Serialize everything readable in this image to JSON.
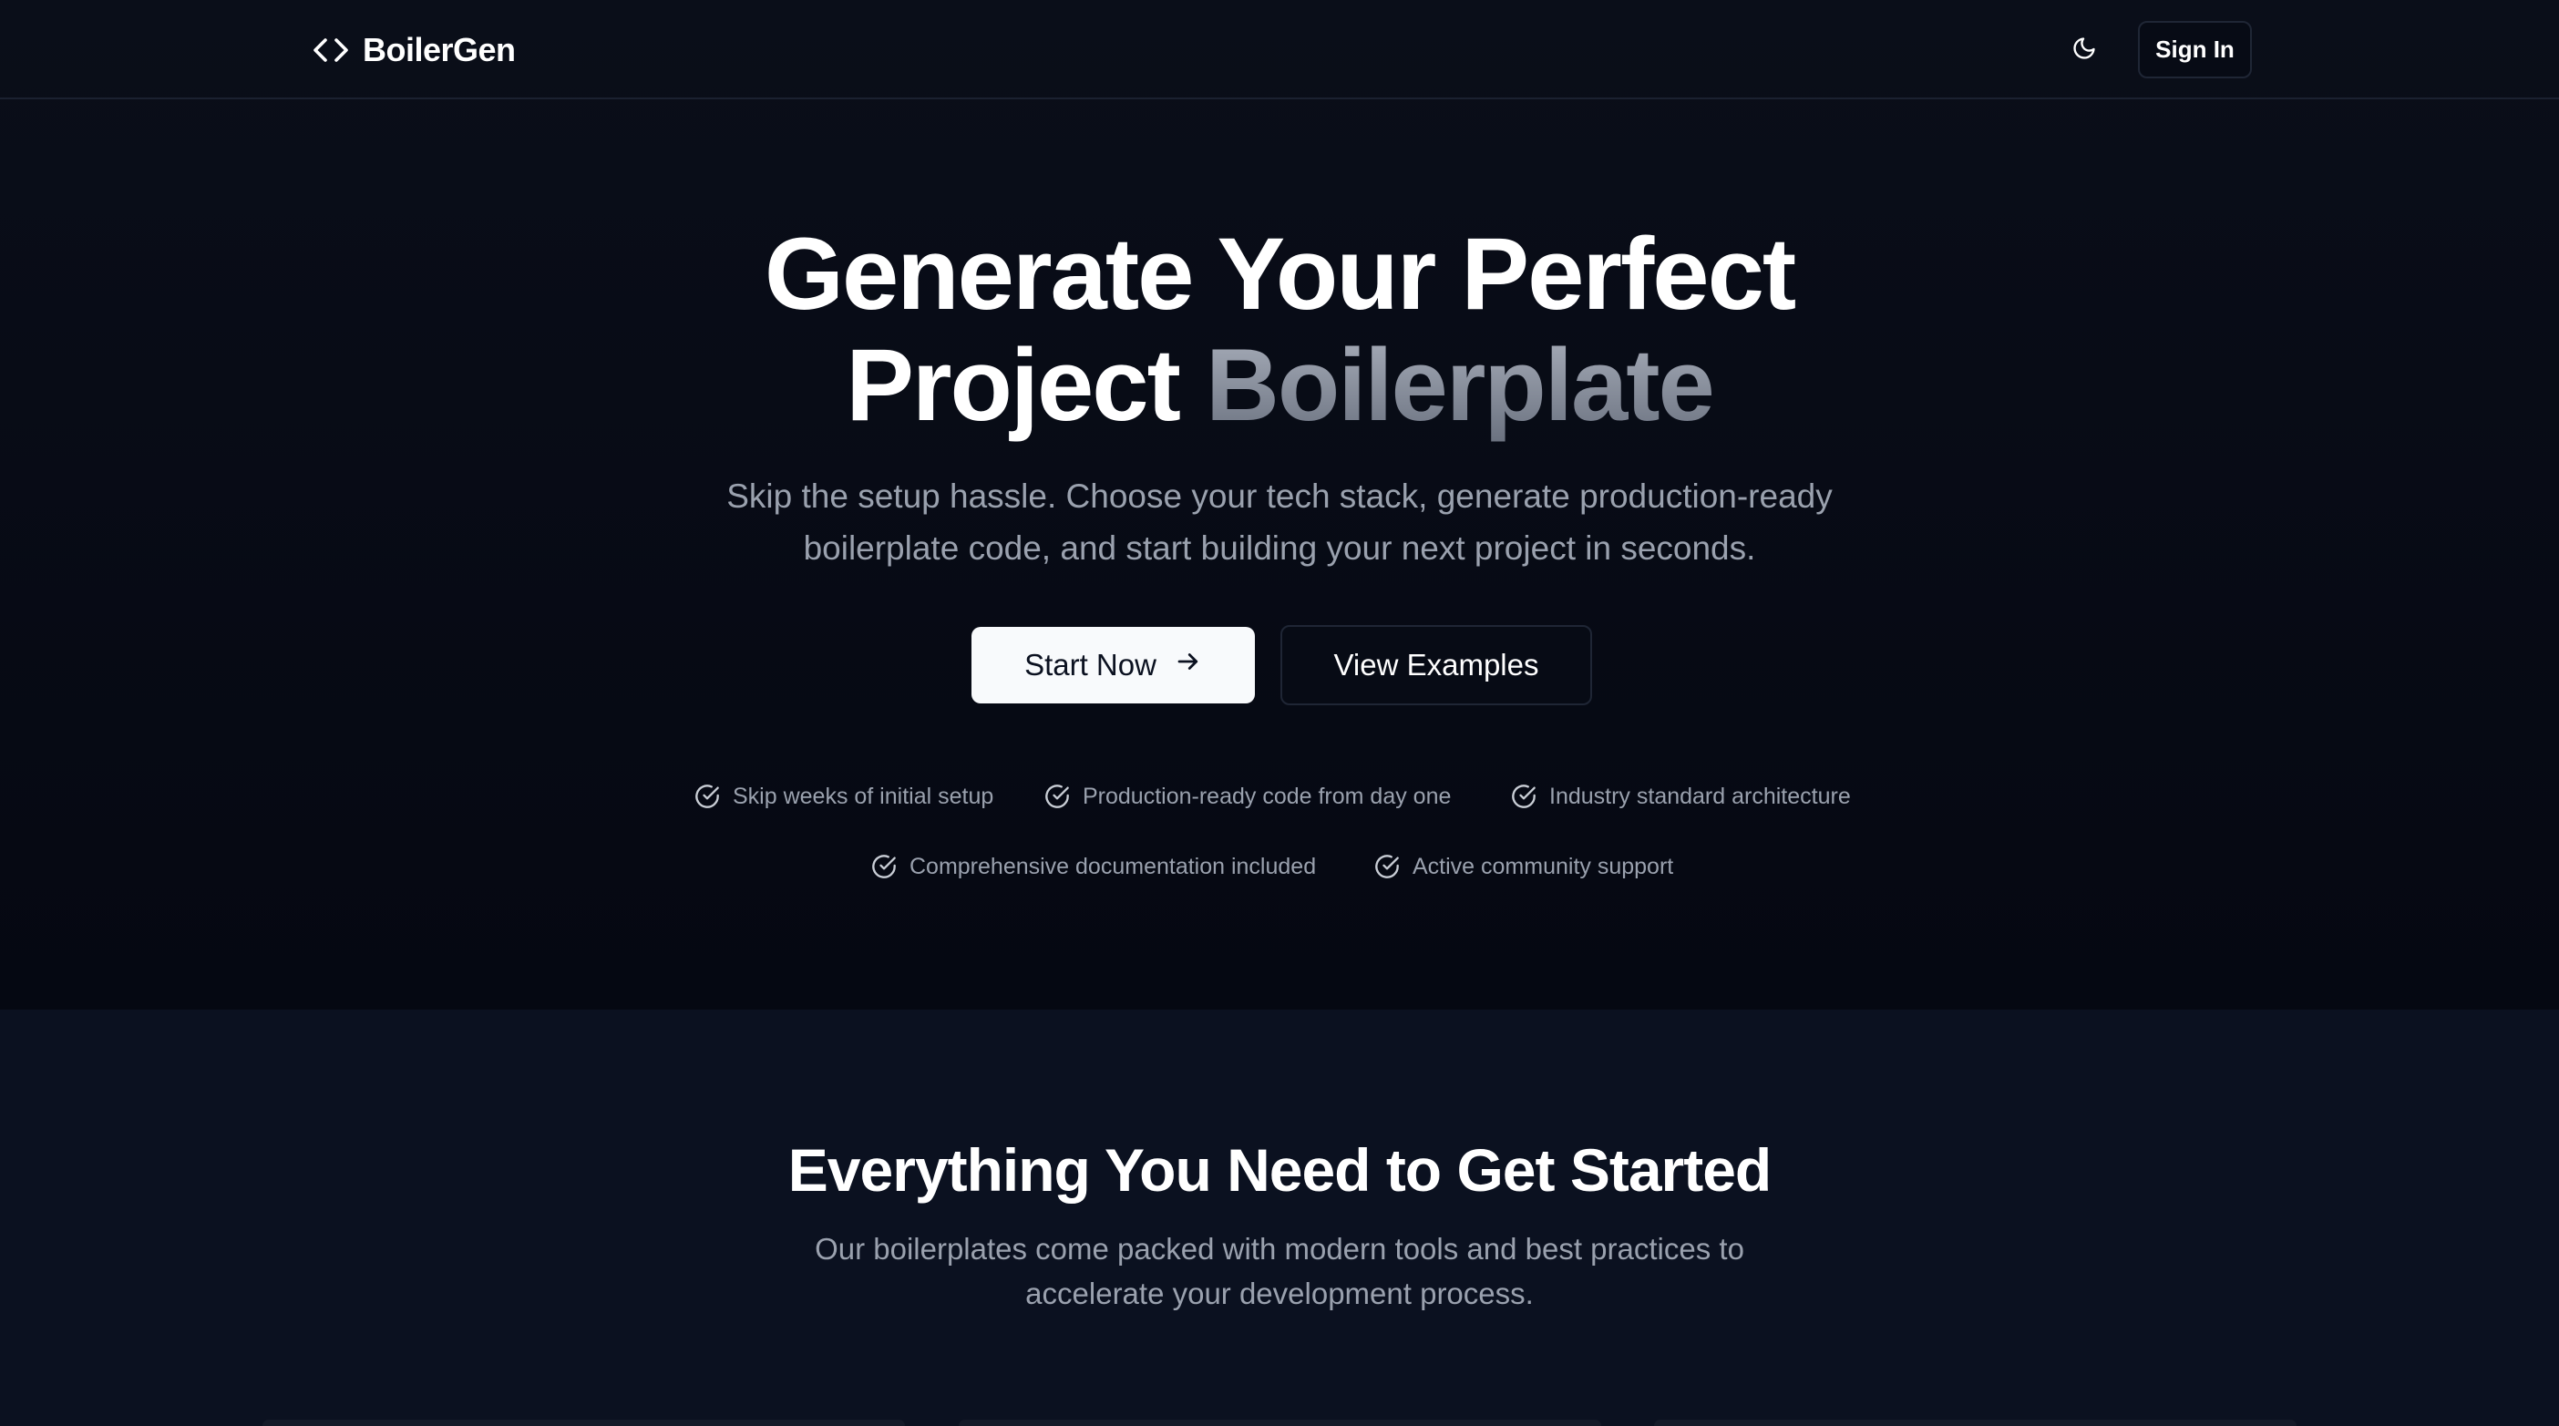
{
  "navbar": {
    "brand": "BoilerGen",
    "brand_icon": "code-brackets-icon",
    "theme_icon": "moon-icon",
    "signin_label": "Sign In"
  },
  "hero": {
    "title_line1": "Generate Your Perfect",
    "title_line2_plain": "Project ",
    "title_line2_accent": "Boilerplate",
    "subtitle_line1": "Skip the setup hassle. Choose your tech stack, generate production-ready",
    "subtitle_line2": "boilerplate code, and start building your next project in seconds.",
    "start_label": "Start Now",
    "start_icon": "arrow-right-icon",
    "examples_label": "View Examples",
    "benefit_icon": "check-circle-icon",
    "benefits": [
      "Skip weeks of initial setup",
      "Production-ready code from day one",
      "Industry standard architecture",
      "Comprehensive documentation included",
      "Active community support"
    ]
  },
  "features": {
    "title": "Everything You Need to Get Started",
    "subtitle_line1": "Our boilerplates come packed with modern tools and best practices to",
    "subtitle_line2": "accelerate your development process."
  },
  "colors": {
    "background": "#060a14",
    "features_background": "#0b1120",
    "primary_button": "#f8fafc",
    "muted_text": "#9aa1ae",
    "accent_gradient_start": "#a9afbb",
    "accent_gradient_end": "#6b7280"
  }
}
